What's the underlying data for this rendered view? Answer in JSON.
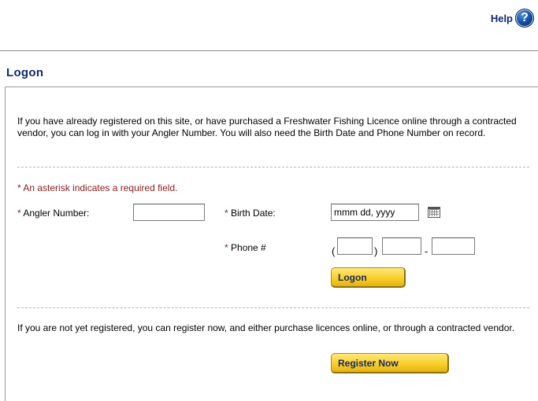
{
  "header": {
    "help_label": "Help",
    "help_icon": "?"
  },
  "section": {
    "title": "Logon"
  },
  "intro_text": "If you have already registered on this site, or have purchased a Freshwater Fishing Licence online through a contracted vendor, you can log in with your Angler Number. You will also need the Birth Date and Phone Number on record.",
  "form": {
    "required_star": "*",
    "required_note": "An asterisk indicates a required field.",
    "angler_number": {
      "label": "Angler Number:",
      "value": ""
    },
    "birth_date": {
      "label": "Birth Date:",
      "placeholder": "mmm dd, yyyy"
    },
    "phone": {
      "label": "Phone #",
      "open_paren": "(",
      "close_paren": ")",
      "separator": "-",
      "area_code": "",
      "prefix": "",
      "line": ""
    },
    "logon_button": "Logon"
  },
  "register": {
    "text": "If you are not yet registered, you can register now, and either purchase licences online, or through a contracted vendor.",
    "button": "Register Now"
  },
  "colors": {
    "accent_blue": "#0f2a6d",
    "required_red": "#8b1a1a",
    "button_gold": "#f9cf2d"
  }
}
